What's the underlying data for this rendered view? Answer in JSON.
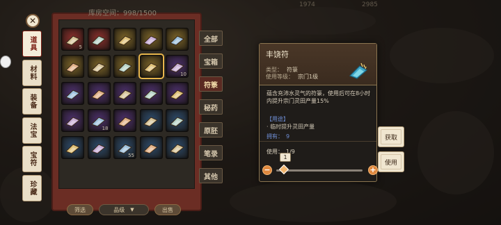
{
  "capacity": {
    "label": "库房空间：",
    "value": "998/1500"
  },
  "top_currency": [
    "1974",
    "2985"
  ],
  "left_categories": [
    {
      "label": "道具",
      "active": true
    },
    {
      "label": "材料",
      "active": false
    },
    {
      "label": "装备",
      "active": false
    },
    {
      "label": "法宝",
      "active": false
    },
    {
      "label": "宝符",
      "active": false
    },
    {
      "label": "珍藏",
      "active": false
    }
  ],
  "right_tabs": [
    {
      "label": "全部",
      "active": false
    },
    {
      "label": "宝箱",
      "active": false
    },
    {
      "label": "符箓",
      "active": true
    },
    {
      "label": "秘药",
      "active": false
    },
    {
      "label": "原胚",
      "active": false
    },
    {
      "label": "笔录",
      "active": false
    },
    {
      "label": "其他",
      "active": false
    }
  ],
  "slots": [
    {
      "rarity": "red",
      "count": "5",
      "icon": "talisman-icon"
    },
    {
      "rarity": "red",
      "count": "",
      "icon": "talisman-icon"
    },
    {
      "rarity": "gold",
      "count": "",
      "icon": "talisman-icon"
    },
    {
      "rarity": "gold",
      "count": "",
      "icon": "talisman-icon"
    },
    {
      "rarity": "gold",
      "count": "",
      "icon": "talisman-icon"
    },
    {
      "rarity": "gold",
      "count": "",
      "icon": "talisman-icon"
    },
    {
      "rarity": "gold",
      "count": "",
      "icon": "talisman-icon"
    },
    {
      "rarity": "gold",
      "count": "",
      "icon": "talisman-icon"
    },
    {
      "rarity": "gold",
      "count": "",
      "icon": "talisman-icon",
      "selected": true
    },
    {
      "rarity": "purple",
      "count": "10",
      "icon": "talisman-icon"
    },
    {
      "rarity": "purple",
      "count": "",
      "icon": "talisman-icon"
    },
    {
      "rarity": "purple",
      "count": "",
      "icon": "talisman-icon"
    },
    {
      "rarity": "purple",
      "count": "",
      "icon": "talisman-icon"
    },
    {
      "rarity": "purple",
      "count": "",
      "icon": "talisman-icon"
    },
    {
      "rarity": "purple",
      "count": "",
      "icon": "talisman-icon"
    },
    {
      "rarity": "purple",
      "count": "",
      "icon": "talisman-icon"
    },
    {
      "rarity": "purple",
      "count": "18",
      "icon": "talisman-icon"
    },
    {
      "rarity": "purple",
      "count": "",
      "icon": "talisman-icon"
    },
    {
      "rarity": "blue",
      "count": "",
      "icon": "talisman-icon"
    },
    {
      "rarity": "blue",
      "count": "",
      "icon": "talisman-icon"
    },
    {
      "rarity": "blue",
      "count": "",
      "icon": "talisman-icon"
    },
    {
      "rarity": "blue",
      "count": "",
      "icon": "talisman-icon"
    },
    {
      "rarity": "blue",
      "count": "55",
      "icon": "talisman-icon"
    },
    {
      "rarity": "blue",
      "count": "",
      "icon": "talisman-icon"
    },
    {
      "rarity": "blue",
      "count": "",
      "icon": "talisman-icon"
    }
  ],
  "filter": {
    "left_button": "筛选",
    "select_value": "品级",
    "right_button": "出售"
  },
  "tooltip": {
    "title": "丰饶符",
    "type_label": "类型：",
    "type_value": "符箓",
    "level_label": "使用等级：",
    "level_value": "宗门1级",
    "description": "蕴含充沛水灵气的符箓，使用后可在8小时内提升宗门灵田产量15%",
    "use_heading": "【用途】",
    "use_body": "· 临时提升灵田产量",
    "own_label": "拥有：",
    "own_value": "9",
    "usage_label": "使用：",
    "usage_value": "1/9",
    "selected_qty": "1",
    "slider_progress": 0.0
  },
  "actions": {
    "get": "获取",
    "use": "使用"
  },
  "colors": {
    "red": "#8a2f2c",
    "gold": "#7a6328",
    "purple": "#4b2f6b",
    "blue": "#2c4a6a",
    "accent": "#e8b64c",
    "use_blue": "#6f8fd6"
  }
}
